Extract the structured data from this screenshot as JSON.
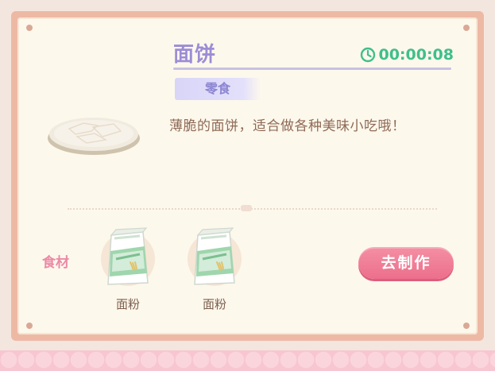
{
  "recipe": {
    "title": "面饼",
    "timer": "00:00:08",
    "category_tag": "零食",
    "description": "薄脆的面饼，适合做各种美味小吃哦！",
    "food_icon": "flatbread-icon"
  },
  "ingredients": {
    "label": "食材",
    "items": [
      {
        "name": "面粉",
        "icon": "flour-bag-icon"
      },
      {
        "name": "面粉",
        "icon": "flour-bag-icon"
      }
    ]
  },
  "actions": {
    "make_label": "去制作"
  },
  "colors": {
    "title": "#9c8dd6",
    "timer": "#3fbf8c",
    "tag_bg": "#d9d5f8",
    "button": "#ec6f8c",
    "ingredient_label": "#ec8aa7",
    "frame": "#edb9a5",
    "card_bg": "#fdf8ec"
  }
}
